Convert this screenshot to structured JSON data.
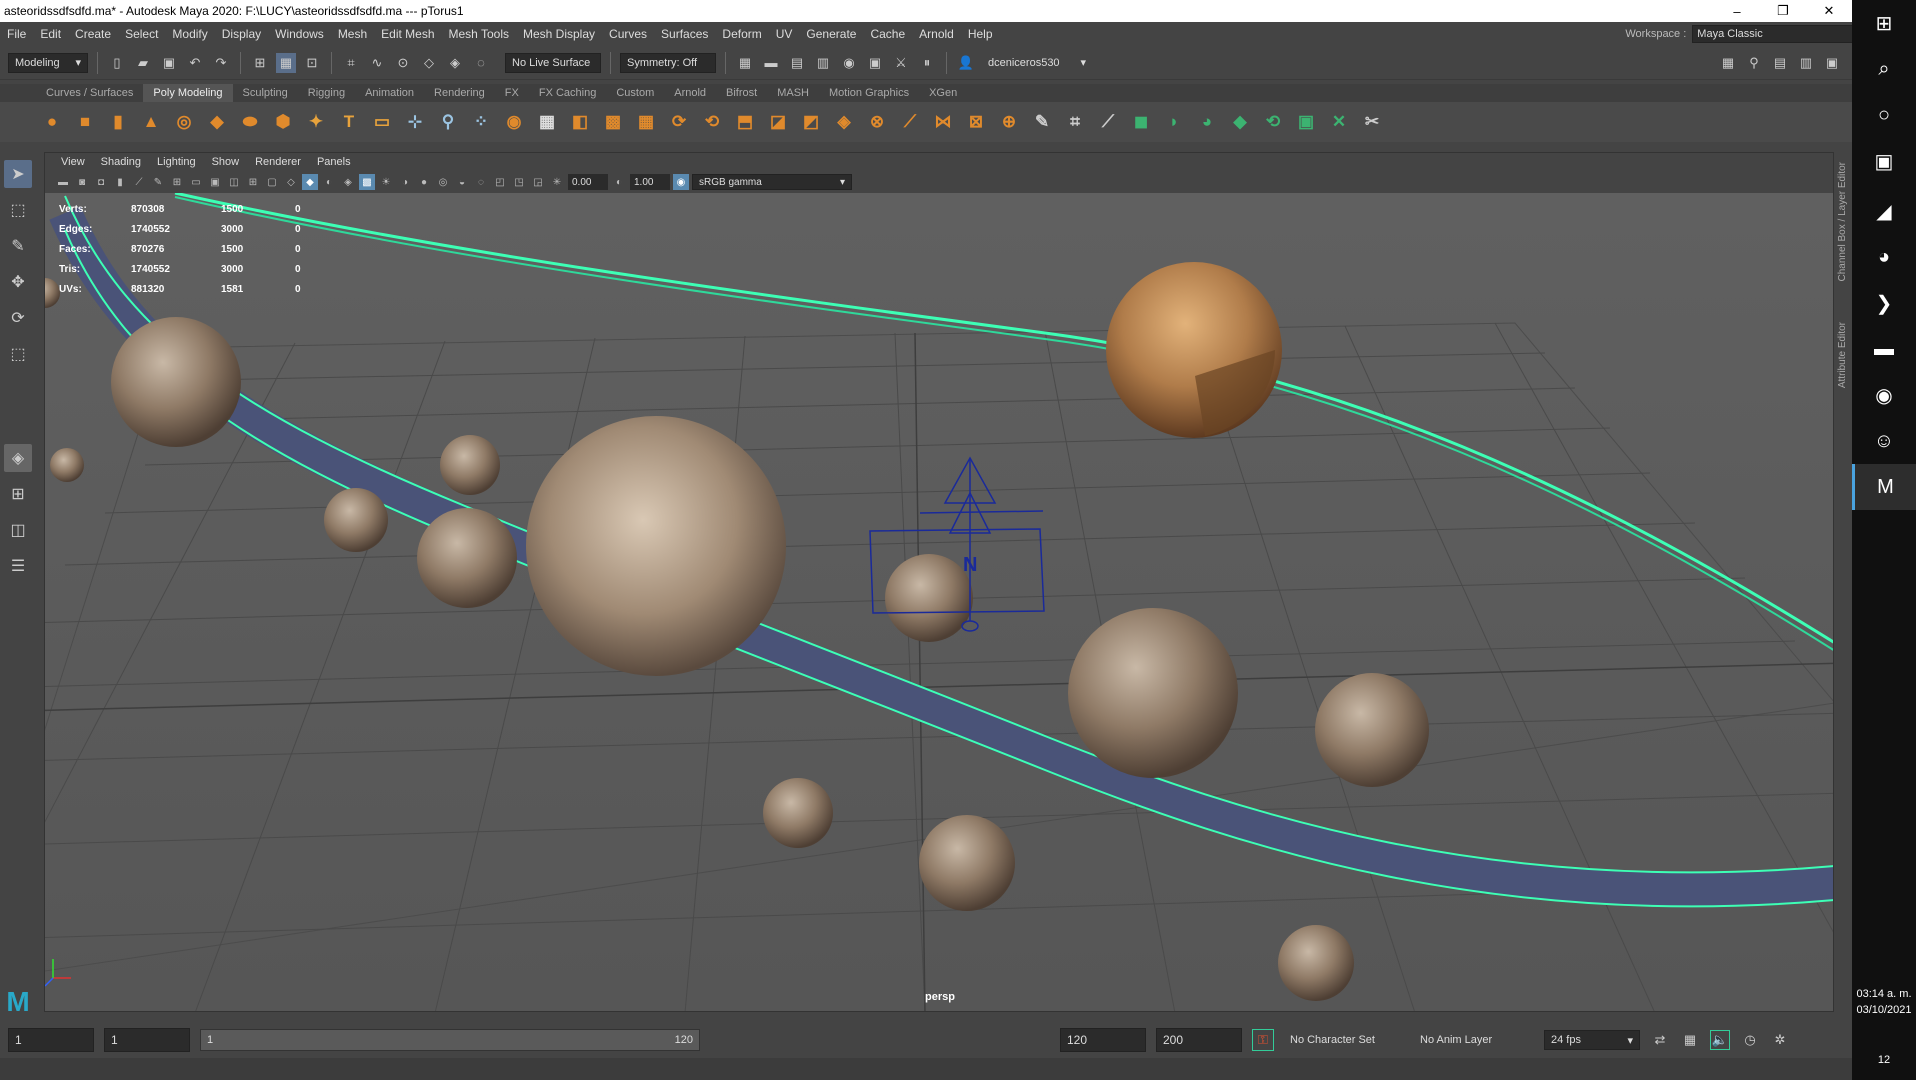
{
  "window": {
    "title": "asteoridssdfsdfd.ma* - Autodesk Maya 2020: F:\\LUCY\\asteoridssdfsdfd.ma   ---   pTorus1",
    "controls": [
      "–",
      "❐",
      "✕"
    ]
  },
  "menubar": {
    "items": [
      "File",
      "Edit",
      "Create",
      "Select",
      "Modify",
      "Display",
      "Windows",
      "Mesh",
      "Edit Mesh",
      "Mesh Tools",
      "Mesh Display",
      "Curves",
      "Surfaces",
      "Deform",
      "UV",
      "Generate",
      "Cache",
      "Arnold",
      "Help"
    ]
  },
  "workspace": {
    "label": "Workspace :",
    "value": "Maya Classic"
  },
  "statusline": {
    "menuset": "Modeling",
    "live_surface": "No Live Surface",
    "symmetry": "Symmetry: Off",
    "user": "dceniceros530"
  },
  "shelf": {
    "tabs": [
      "Curves / Surfaces",
      "Poly Modeling",
      "Sculpting",
      "Rigging",
      "Animation",
      "Rendering",
      "FX",
      "FX Caching",
      "Custom",
      "Arnold",
      "Bifrost",
      "MASH",
      "Motion Graphics",
      "XGen"
    ],
    "active_tab": "Poly Modeling",
    "icons": [
      {
        "name": "sphere-icon",
        "glyph": "●",
        "color": "#e08a2c"
      },
      {
        "name": "cube-icon",
        "glyph": "■",
        "color": "#e08a2c"
      },
      {
        "name": "cylinder-icon",
        "glyph": "▮",
        "color": "#e08a2c"
      },
      {
        "name": "cone-icon",
        "glyph": "▲",
        "color": "#e08a2c"
      },
      {
        "name": "torus-icon",
        "glyph": "◎",
        "color": "#e08a2c"
      },
      {
        "name": "plane-icon",
        "glyph": "◆",
        "color": "#e08a2c"
      },
      {
        "name": "disc-icon",
        "glyph": "⬬",
        "color": "#e08a2c"
      },
      {
        "name": "platonic-icon",
        "glyph": "⬢",
        "color": "#e08a2c"
      },
      {
        "name": "super-shape-icon",
        "glyph": "✦",
        "color": "#e8a33c"
      },
      {
        "name": "type-icon",
        "glyph": "T",
        "color": "#e8a33c"
      },
      {
        "name": "svg-icon",
        "glyph": "▭",
        "color": "#e8a33c"
      },
      {
        "name": "measure-icon",
        "glyph": "⊹",
        "color": "#9bc4e2"
      },
      {
        "name": "combine-icon",
        "glyph": "⚲",
        "color": "#9bc4e2"
      },
      {
        "name": "separate-icon",
        "glyph": "⁘",
        "color": "#9bc4e2"
      },
      {
        "name": "smooth-icon",
        "glyph": "◉",
        "color": "#e08a2c"
      },
      {
        "name": "bool-icon",
        "glyph": "▦",
        "color": "#dddddd"
      },
      {
        "name": "mirror-icon",
        "glyph": "◧",
        "color": "#e08a2c"
      },
      {
        "name": "extract-icon",
        "glyph": "▩",
        "color": "#e08a2c"
      },
      {
        "name": "remesh-icon",
        "glyph": "▦",
        "color": "#e08a2c"
      },
      {
        "name": "bridge-icon",
        "glyph": "⟳",
        "color": "#e08a2c"
      },
      {
        "name": "fill-hole-icon",
        "glyph": "⟲",
        "color": "#e08a2c"
      },
      {
        "name": "extrude-icon",
        "glyph": "⬒",
        "color": "#e08a2c"
      },
      {
        "name": "bevel-icon",
        "glyph": "◪",
        "color": "#e08a2c"
      },
      {
        "name": "append-icon",
        "glyph": "◩",
        "color": "#e08a2c"
      },
      {
        "name": "multicut-icon",
        "glyph": "◈",
        "color": "#e08a2c"
      },
      {
        "name": "target-weld-icon",
        "glyph": "⊗",
        "color": "#e08a2c"
      },
      {
        "name": "connect-icon",
        "glyph": "⟋",
        "color": "#e08a2c"
      },
      {
        "name": "collapse-icon",
        "glyph": "⋈",
        "color": "#e08a2c"
      },
      {
        "name": "poke-icon",
        "glyph": "⊠",
        "color": "#e08a2c"
      },
      {
        "name": "wedge-icon",
        "glyph": "⊕",
        "color": "#e08a2c"
      },
      {
        "name": "sculpt-icon",
        "glyph": "✎",
        "color": "#cccccc"
      },
      {
        "name": "bounding-icon",
        "glyph": "⌗",
        "color": "#cccccc"
      },
      {
        "name": "cut-icon",
        "glyph": "⟋",
        "color": "#cccccc"
      },
      {
        "name": "uv-planar-icon",
        "glyph": "◼",
        "color": "#3cb371"
      },
      {
        "name": "uv-cylindrical-icon",
        "glyph": "◗",
        "color": "#3cb371"
      },
      {
        "name": "uv-spherical-icon",
        "glyph": "◕",
        "color": "#3cb371"
      },
      {
        "name": "uv-auto-icon",
        "glyph": "◆",
        "color": "#3cb371"
      },
      {
        "name": "uv-unfold-icon",
        "glyph": "⟲",
        "color": "#3cb371"
      },
      {
        "name": "uv-layout-icon",
        "glyph": "▣",
        "color": "#3cb371"
      },
      {
        "name": "uv-sew-icon",
        "glyph": "✕",
        "color": "#3cb371"
      },
      {
        "name": "uv-cut-icon",
        "glyph": "✂",
        "color": "#cccccc"
      }
    ]
  },
  "toolbox": [
    "select-tool-icon",
    "lasso-tool-icon",
    "paint-select-icon",
    "move-tool-icon",
    "rotate-tool-icon",
    "scale-tool-icon"
  ],
  "panel": {
    "menus": [
      "View",
      "Shading",
      "Lighting",
      "Show",
      "Renderer",
      "Panels"
    ],
    "exposure": "0.00",
    "gamma": "1.00",
    "color_space": "sRGB gamma",
    "camera_label": "persp"
  },
  "hud": [
    {
      "label": "Verts:",
      "a": "870308",
      "b": "1500",
      "c": "0"
    },
    {
      "label": "Edges:",
      "a": "1740552",
      "b": "3000",
      "c": "0"
    },
    {
      "label": "Faces:",
      "a": "870276",
      "b": "1500",
      "c": "0"
    },
    {
      "label": "Tris:",
      "a": "1740552",
      "b": "3000",
      "c": "0"
    },
    {
      "label": "UVs:",
      "a": "881320",
      "b": "1581",
      "c": "0"
    }
  ],
  "side_tabs": [
    "Channel Box / Layer Editor",
    "Attribute Editor"
  ],
  "timeslider": {
    "start": "1",
    "current": "1",
    "range_start": "1",
    "range_end": "120",
    "end": "120",
    "anim_end": "200",
    "character_set": "No Character Set",
    "anim_layer": "No Anim Layer",
    "fps": "24 fps"
  },
  "taskbar": {
    "items": [
      "windows-icon",
      "search-icon",
      "cortana-icon",
      "task-view-icon",
      "maya-2020-icon",
      "paint-icon",
      "powershell-icon",
      "explorer-icon",
      "chrome-icon",
      "discord-icon",
      "maya-icon"
    ],
    "glyphs": [
      "⊞",
      "⌕",
      "○",
      "▣",
      "◢",
      "◕",
      "❯",
      "▬",
      "◉",
      "☺",
      "M"
    ],
    "time": "03:14 a. m.",
    "date": "03/10/2021",
    "notifications": "12"
  },
  "colors": {
    "wire": "#3dffb5",
    "ring": "#4a5378",
    "rock": "#8f7a66",
    "rock_big_orange": "#b07c4a"
  }
}
